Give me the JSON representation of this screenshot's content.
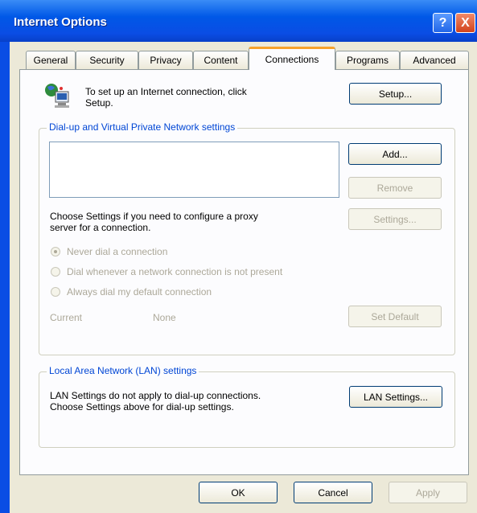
{
  "window": {
    "title": "Internet Options",
    "help_glyph": "?",
    "close_glyph": "X"
  },
  "tabs": [
    {
      "label": "General"
    },
    {
      "label": "Security"
    },
    {
      "label": "Privacy"
    },
    {
      "label": "Content"
    },
    {
      "label": "Connections",
      "active": true
    },
    {
      "label": "Programs"
    },
    {
      "label": "Advanced"
    }
  ],
  "setup": {
    "text_line1": "To set up an Internet connection, click",
    "text_line2": "Setup.",
    "button": "Setup..."
  },
  "dialup": {
    "group_label": "Dial-up and Virtual Private Network settings",
    "add_button": "Add...",
    "remove_button": "Remove",
    "settings_button": "Settings...",
    "proxy_text_line1": "Choose Settings if you need to configure a proxy",
    "proxy_text_line2": "server for a connection.",
    "radios": [
      {
        "label": "Never dial a connection",
        "selected": true
      },
      {
        "label": "Dial whenever a network connection is not present",
        "selected": false
      },
      {
        "label": "Always dial my default connection",
        "selected": false
      }
    ],
    "current_label": "Current",
    "current_value": "None",
    "set_default_button": "Set Default"
  },
  "lan": {
    "group_label": "Local Area Network (LAN) settings",
    "text_line1": "LAN Settings do not apply to dial-up connections.",
    "text_line2": "Choose Settings above for dial-up settings.",
    "button": "LAN Settings..."
  },
  "footer": {
    "ok": "OK",
    "cancel": "Cancel",
    "apply": "Apply"
  },
  "colors": {
    "titlebar": "#0a4de4",
    "group_label": "#0046d5",
    "active_tab_accent": "#f6a22c",
    "disabled_text": "#aca899"
  }
}
